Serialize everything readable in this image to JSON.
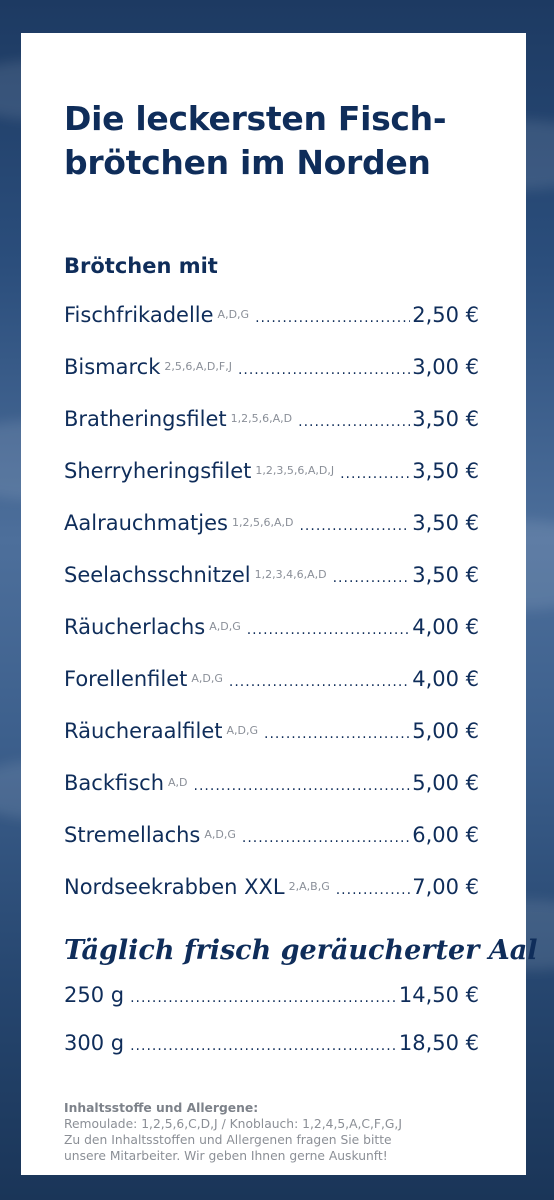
{
  "title": "Die leckersten Fisch-brötchen im Norden",
  "section_title": "Brötchen mit",
  "items": [
    {
      "name": "Fischfrikadelle",
      "allergens": "A,D,G",
      "price": "2,50 €"
    },
    {
      "name": "Bismarck",
      "allergens": "2,5,6,A,D,F,J",
      "price": "3,00 €"
    },
    {
      "name": "Bratheringsfilet",
      "allergens": "1,2,5,6,A,D",
      "price": "3,50 €"
    },
    {
      "name": "Sherryheringsfilet",
      "allergens": "1,2,3,5,6,A,D,J",
      "price": "3,50 €"
    },
    {
      "name": "Aalrauchmatjes",
      "allergens": "1,2,5,6,A,D",
      "price": "3,50 €"
    },
    {
      "name": "Seelachsschnitzel",
      "allergens": "1,2,3,4,6,A,D",
      "price": "3,50 €"
    },
    {
      "name": "Räucherlachs",
      "allergens": "A,D,G",
      "price": "4,00 €"
    },
    {
      "name": "Forellenfilet",
      "allergens": "A,D,G",
      "price": "4,00 €"
    },
    {
      "name": "Räucheraalfilet",
      "allergens": "A,D,G",
      "price": "5,00 €"
    },
    {
      "name": "Backfisch",
      "allergens": "A,D",
      "price": "5,00 €"
    },
    {
      "name": "Stremellachs",
      "allergens": "A,D,G",
      "price": "6,00 €"
    },
    {
      "name": "Nordseekrabben XXL",
      "allergens": "2,A,B,G",
      "price": "7,00 €"
    }
  ],
  "aal": {
    "heading": "Täglich frisch geräucherter Aal",
    "items": [
      {
        "weight": "250 g",
        "price": "14,50 €"
      },
      {
        "weight": "300 g",
        "price": "18,50 €"
      }
    ]
  },
  "footnote": {
    "title": "Inhaltsstoffe und Allergene:",
    "lines": [
      "Remoulade: 1,2,5,6,C,D,J / Knoblauch: 1,2,4,5,A,C,F,G,J",
      "Zu den Inhaltsstoffen und Allergenen fragen Sie bitte",
      "unsere Mitarbeiter. Wir geben Ihnen gerne Auskunft!"
    ]
  },
  "colors": {
    "navy": "#0f2d5a",
    "allergen_grey": "#8a8f98",
    "card": "#ffffff",
    "background": "#2b4e7c"
  }
}
